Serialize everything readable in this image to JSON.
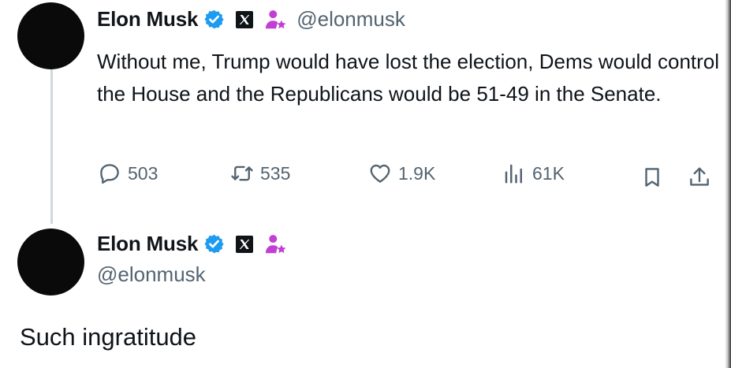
{
  "tweet": {
    "author": {
      "display_name": "Elon Musk",
      "handle": "@elonmusk",
      "badges": [
        "verified-badge-icon",
        "x-affiliate-badge-icon",
        "staff-person-star-icon"
      ]
    },
    "text": "Without me, Trump would have lost the election, Dems would control the House and the Republicans would be 51-49 in the Senate.",
    "metrics": {
      "replies": "503",
      "reposts": "535",
      "likes": "1.9K",
      "views": "61K"
    },
    "actions": [
      "reply-icon",
      "repost-icon",
      "like-icon",
      "views-icon",
      "bookmark-icon",
      "share-icon"
    ]
  },
  "reply": {
    "author": {
      "display_name": "Elon Musk",
      "handle": "@elonmusk"
    },
    "text": "Such ingratitude"
  },
  "colors": {
    "text": "#0f1419",
    "secondary": "#536471",
    "verified": "#1d9bf0",
    "staff_badge": "#c13fd4",
    "thread_line": "#cfd9de"
  }
}
